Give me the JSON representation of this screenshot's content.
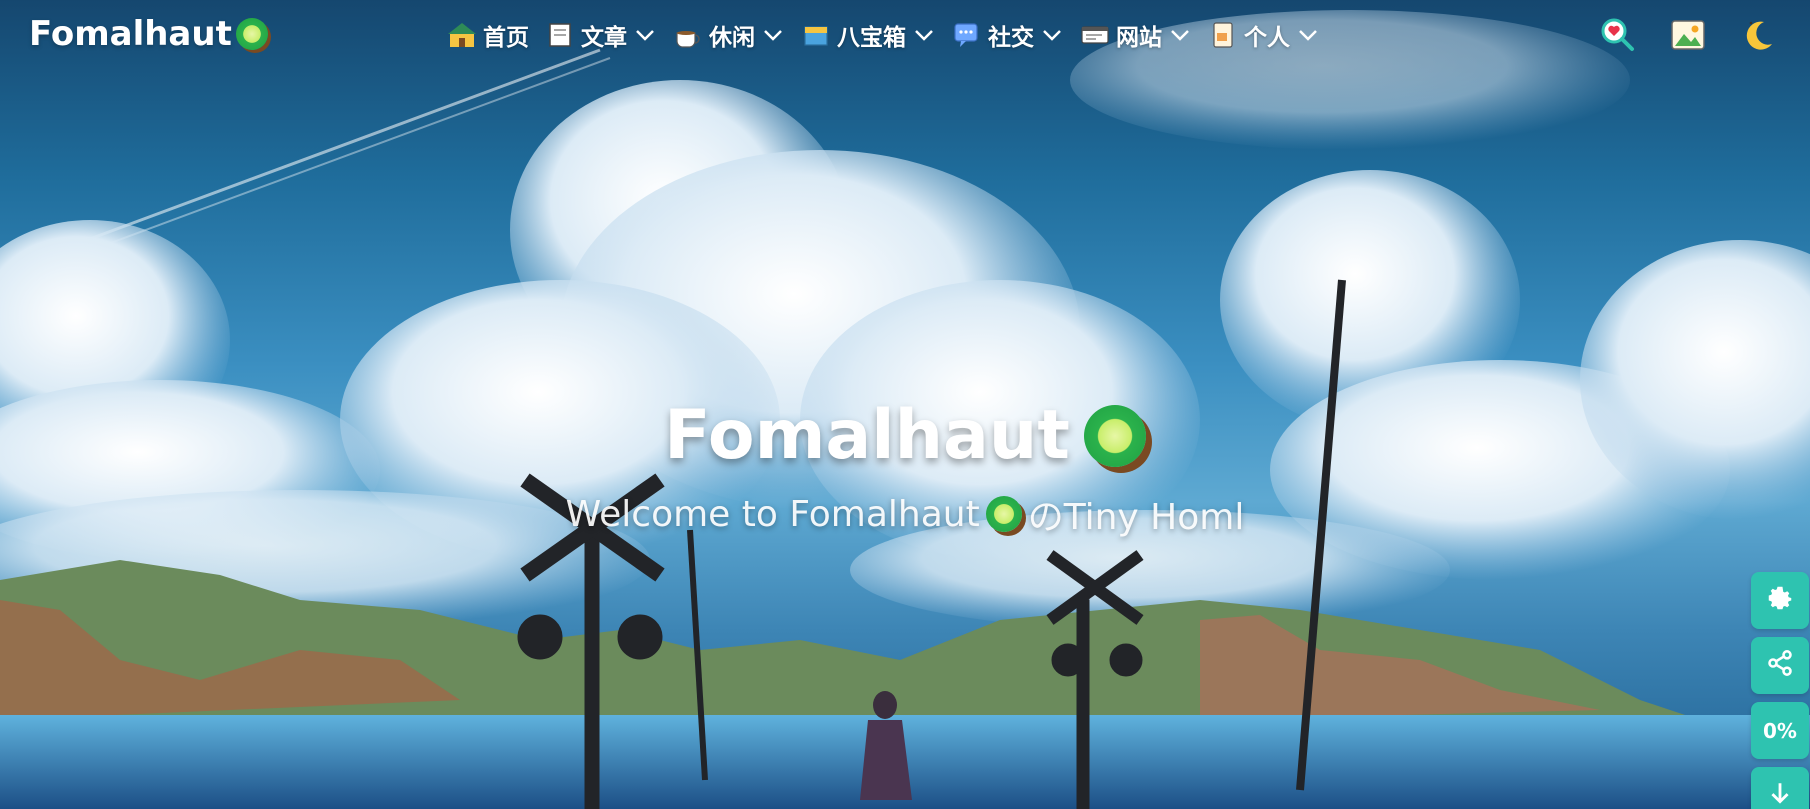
{
  "brand": {
    "name": "Fomalhaut"
  },
  "nav": {
    "items": [
      {
        "label": "首页",
        "icon": "house-icon",
        "has_dropdown": false
      },
      {
        "label": "文章",
        "icon": "book-icon",
        "has_dropdown": true
      },
      {
        "label": "休闲",
        "icon": "coffee-icon",
        "has_dropdown": true
      },
      {
        "label": "八宝箱",
        "icon": "box-icon",
        "has_dropdown": true
      },
      {
        "label": "社交",
        "icon": "chat-icon",
        "has_dropdown": true
      },
      {
        "label": "网站",
        "icon": "website-icon",
        "has_dropdown": true
      },
      {
        "label": "个人",
        "icon": "notebook-icon",
        "has_dropdown": true
      }
    ],
    "tools": [
      {
        "name": "search",
        "icon": "magnifier-heart-icon"
      },
      {
        "name": "wallpaper",
        "icon": "picture-icon"
      },
      {
        "name": "dark-mode",
        "icon": "moon-icon"
      }
    ]
  },
  "hero": {
    "title": "Fomalhaut",
    "subtitle_before": "Welcome to Fomalhaut",
    "subtitle_after": "のTiny Homl"
  },
  "side_buttons": {
    "settings": "settings",
    "share": "share",
    "progress": "0%",
    "down": "down"
  },
  "colors": {
    "accent": "#2ec3b0",
    "text": "#ffffff"
  }
}
